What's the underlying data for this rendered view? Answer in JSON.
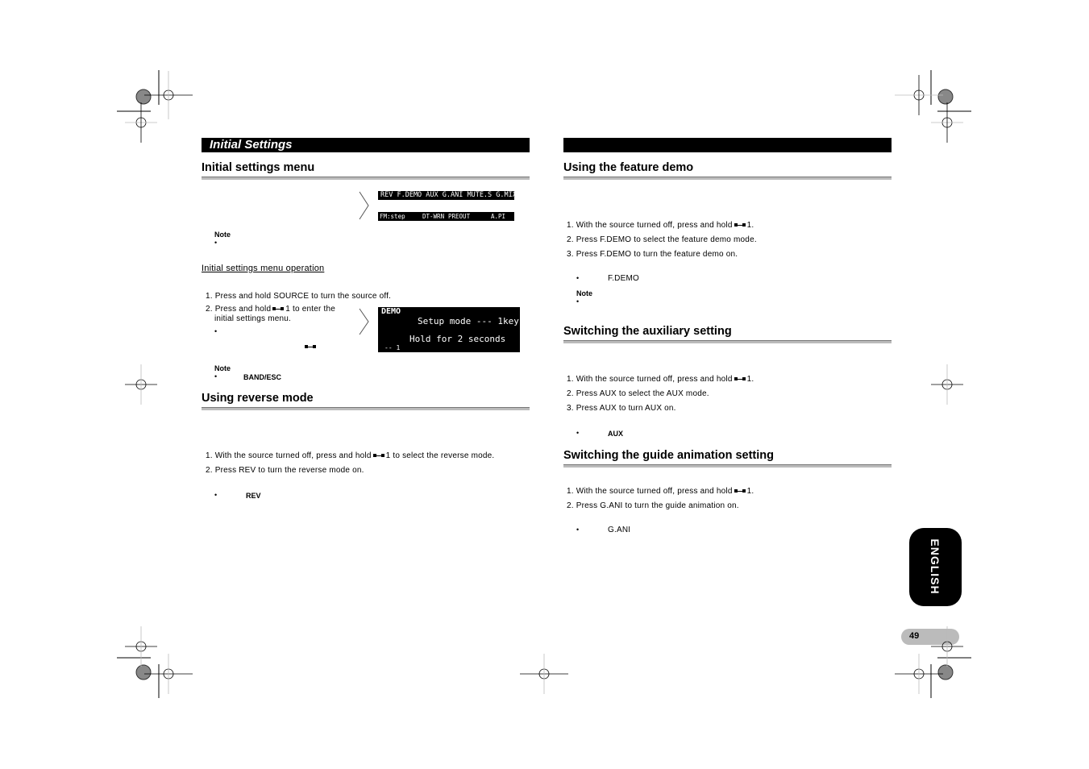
{
  "left": {
    "header_bar": "Initial Settings",
    "section1": {
      "title": "Initial settings menu",
      "display_row1": "REV F.DEMO AUX G.ANI MUTE.S G.MIX",
      "display_row2_items": [
        "FM:step",
        "DT-WRN",
        "PREOUT",
        "A.PI"
      ],
      "note_label": "Note"
    },
    "subsection": {
      "title": "Initial settings menu operation",
      "step1": "1. Press and hold SOURCE to turn the source off.",
      "step2_a": "2. Press and hold",
      "step2_b": "1 to enter the",
      "step2_c": "initial settings menu.",
      "demo_display": {
        "title": "DEMO",
        "line1": "Setup mode --- 1key",
        "line2": "Hold for 2 seconds",
        "footer": "-- 1"
      },
      "note_label": "Note",
      "note_bullet": "BAND/ESC"
    },
    "section2": {
      "title": "Using reverse mode",
      "step1_a": "1. With the source turned off, press and hold",
      "step1_b": "1 to select the reverse mode.",
      "step2": "2. Press REV to turn the reverse mode on.",
      "bullet": "REV"
    }
  },
  "right": {
    "section1": {
      "title": "Using the feature demo",
      "step1_a": "1. With the source turned off, press and hold",
      "step1_b": "1.",
      "step2": "2. Press F.DEMO to select the feature demo mode.",
      "step3": "3. Press F.DEMO to turn the feature demo on.",
      "bullet": "F.DEMO",
      "note_label": "Note"
    },
    "section2": {
      "title": "Switching the auxiliary setting",
      "step1_a": "1. With the source turned off, press and hold",
      "step1_b": "1.",
      "step2": "2. Press AUX to select the AUX mode.",
      "step3": "3. Press AUX to turn AUX on.",
      "bullet": "AUX"
    },
    "section3": {
      "title": "Switching the guide animation setting",
      "step1_a": "1. With the source turned off, press and hold",
      "step1_b": "1.",
      "step2": "2. Press G.ANI to turn the guide animation on.",
      "bullet": "G.ANI"
    }
  },
  "side_tab": "ENGLISH",
  "page_number": "49"
}
